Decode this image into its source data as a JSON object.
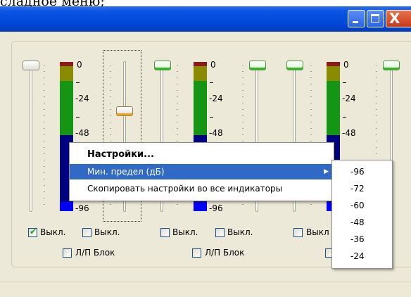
{
  "caption": "сладное меню;",
  "window": {
    "minimize_icon": "minimize-icon",
    "maximize_icon": "maximize-icon",
    "close_icon": "close-icon",
    "close_glyph": "X"
  },
  "meters": {
    "labels": [
      "0",
      "-24",
      "-48",
      "-96"
    ]
  },
  "checkboxes": {
    "off_label": "Выкл.",
    "off_label_truncated": "Выкл",
    "lr_lock_label": "Л/П Блок",
    "first_checked": true
  },
  "context_menu": {
    "items": [
      {
        "label": "Настройки..."
      },
      {
        "label": "Мин. предел (дБ)"
      },
      {
        "label": "Скопировать настройки во все индикаторы"
      }
    ]
  },
  "submenu": {
    "items": [
      "-96",
      "-72",
      "-60",
      "-48",
      "-36",
      "-24"
    ]
  },
  "colors": {
    "menu_highlight": "#316ac5",
    "meter_red": "#8b1a1a",
    "meter_olive": "#8b8b00",
    "meter_green": "#149614",
    "meter_navy": "#000080",
    "meter_blue": "#0000ff"
  }
}
